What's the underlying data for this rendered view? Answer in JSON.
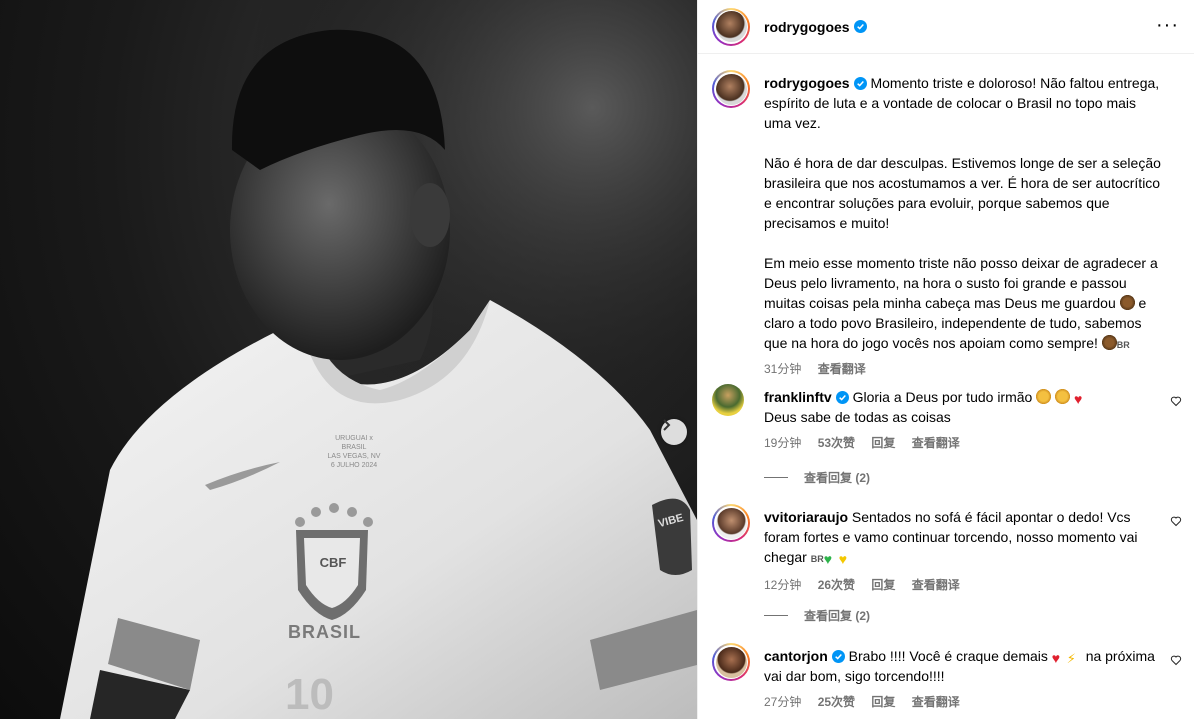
{
  "photo": {
    "jersey_text": "BRASIL",
    "badge_text": "CBF",
    "match_line1": "URUGUAI x BRASIL",
    "match_line2": "LAS VEGAS, NV",
    "match_line3": "6 JULHO 2024",
    "sleeve_text": "VIBE",
    "number": "10"
  },
  "header": {
    "username": "rodrygogoes"
  },
  "caption": {
    "username": "rodrygogoes",
    "para1": "Momento triste e doloroso! Não faltou entrega, espírito de luta e a vontade de colocar o Brasil no topo mais uma vez.",
    "para2": "Não é hora de dar desculpas. Estivemos longe de ser a seleção brasileira que nos acostumamos a ver. É hora de ser autocrítico e encontrar soluções para evoluir, porque sabemos que precisamos e muito!",
    "para3_a": "Em meio esse momento triste não posso deixar de agradecer a Deus pelo livramento, na hora o susto foi grande e passou muitas coisas pela minha cabeça mas Deus me guardou",
    "para3_b": "e claro a todo povo Brasileiro, independente de tudo, sabemos que na hora do jogo vocês nos apoiam como sempre!",
    "flag": "BR",
    "time": "31分钟",
    "translate": "查看翻译"
  },
  "comments": [
    {
      "username": "franklinftv",
      "text_a": "Gloria a Deus por tudo irmão",
      "text_b": "Deus sabe de todas as coisas",
      "time": "19分钟",
      "likes": "53次赞",
      "reply": "回复",
      "translate": "查看翻译",
      "view_replies": "查看回复 (2)"
    },
    {
      "username": "vvitoriaraujo",
      "text": "Sentados no sofá é fácil apontar o dedo! Vcs foram fortes e vamo continuar torcendo, nosso momento vai chegar",
      "flag": "BR",
      "time": "12分钟",
      "likes": "26次赞",
      "reply": "回复",
      "translate": "查看翻译",
      "view_replies": "查看回复 (2)"
    },
    {
      "username": "cantorjon",
      "text_a": "Brabo !!!! Você é craque demais",
      "text_b": "na próxima vai dar bom, sigo torcendo!!!!",
      "time": "27分钟",
      "likes": "25次赞",
      "reply": "回复",
      "translate": "查看翻译"
    }
  ],
  "colors": {
    "verified": "#0095f6",
    "meta": "#737373",
    "border": "#efefef"
  }
}
